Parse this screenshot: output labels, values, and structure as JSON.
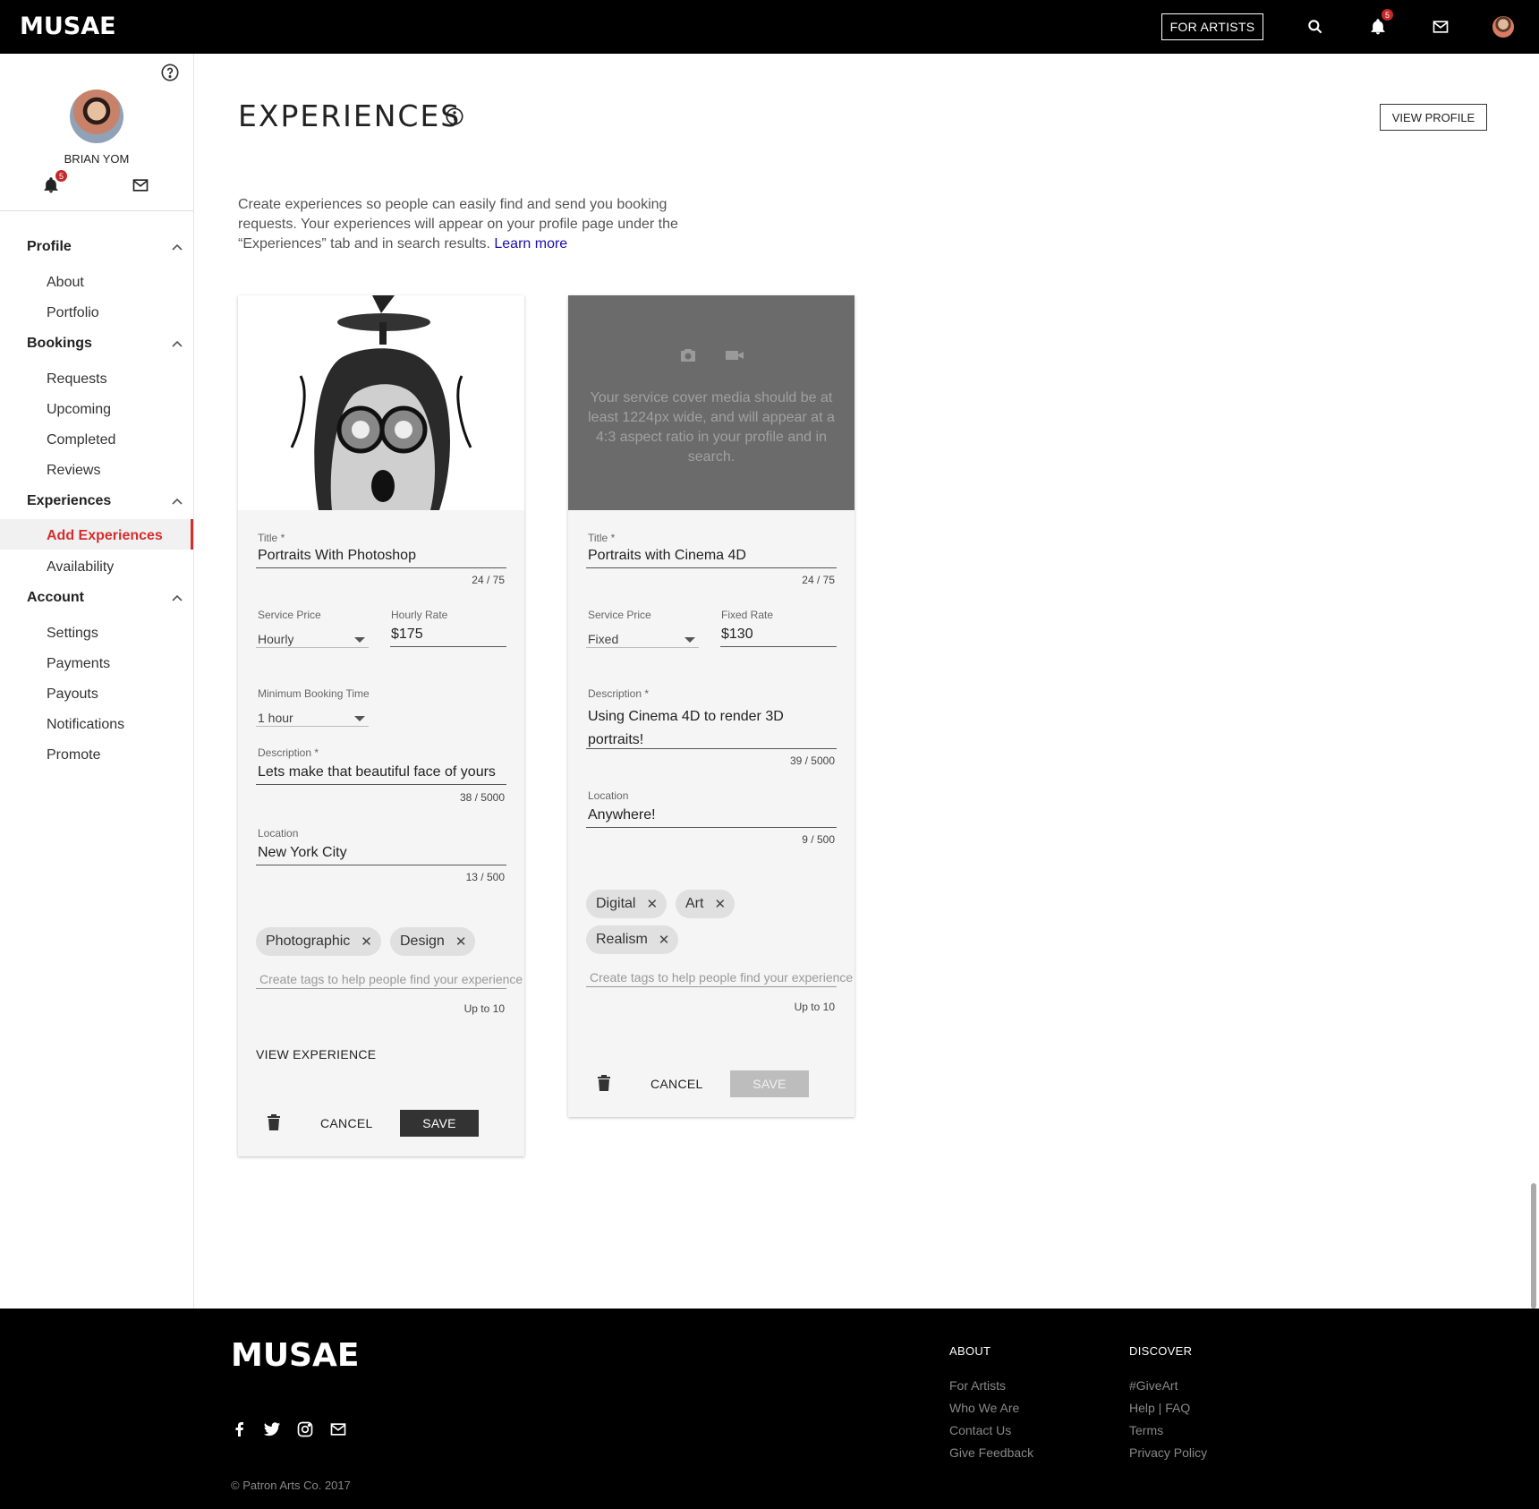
{
  "header": {
    "logo": "MUSAE",
    "for_artists_label": "FOR ARTISTS",
    "notification_count": "5"
  },
  "sidebar": {
    "user_name": "BRIAN YOM",
    "notification_count": "5",
    "sections": [
      {
        "label": "Profile",
        "items": [
          "About",
          "Portfolio"
        ]
      },
      {
        "label": "Bookings",
        "items": [
          "Requests",
          "Upcoming",
          "Completed",
          "Reviews"
        ]
      },
      {
        "label": "Experiences",
        "items": [
          "Add Experiences",
          "Availability"
        ]
      },
      {
        "label": "Account",
        "items": [
          "Settings",
          "Payments",
          "Payouts",
          "Notifications",
          "Promote"
        ]
      }
    ],
    "active_item": "Add Experiences"
  },
  "main": {
    "title": "EXPERIENCES",
    "view_profile_label": "VIEW PROFILE",
    "intro_text": "Create experiences so people can easily find and send you booking requests. Your experiences will appear on your profile page under the “Experiences” tab and in search results.",
    "learn_more": "Learn more"
  },
  "cards": [
    {
      "title_label": "Title",
      "title_value": "Portraits With Photoshop",
      "title_counter": "24 / 75",
      "price_label": "Service Price",
      "price_value": "Hourly",
      "rate_label": "Hourly Rate",
      "rate_value": "$175",
      "min_booking_label": "Minimum Booking Time",
      "min_booking_value": "1 hour",
      "description_label": "Description",
      "description_value": "Lets make that beautiful face of yours",
      "description_counter": "38 / 5000",
      "location_label": "Location",
      "location_value": "New York City",
      "location_counter": "13 / 500",
      "tags": [
        "Photographic",
        "Design"
      ],
      "tag_placeholder": "Create tags to help people find your experience",
      "tag_limit": "Up to 10",
      "view_experience_label": "VIEW EXPERIENCE",
      "cancel_label": "CANCEL",
      "save_label": "SAVE"
    },
    {
      "media_hint": "Your service cover media should be at least 1224px wide, and will appear at a 4:3 aspect ratio in your profile and in search.",
      "title_label": "Title",
      "title_value": "Portraits with Cinema 4D",
      "title_counter": "24 / 75",
      "price_label": "Service Price",
      "price_value": "Fixed",
      "rate_label": "Fixed Rate",
      "rate_value": "$130",
      "description_label": "Description",
      "description_value": "Using Cinema 4D to render 3D portraits!",
      "description_counter": "39 / 5000",
      "location_label": "Location",
      "location_value": "Anywhere!",
      "location_counter": "9 / 500",
      "tags": [
        "Digital",
        "Art",
        "Realism"
      ],
      "tag_placeholder": "Create tags to help people find your experience",
      "tag_limit": "Up to 10",
      "cancel_label": "CANCEL",
      "save_label": "SAVE"
    }
  ],
  "footer": {
    "logo": "MUSAE",
    "about_heading": "ABOUT",
    "about_links": [
      "For Artists",
      "Who We Are",
      "Contact Us",
      "Give Feedback"
    ],
    "discover_heading": "DISCOVER",
    "discover_links": [
      "#GiveArt",
      "Help | FAQ",
      "Terms",
      "Privacy Policy"
    ],
    "copyright": "© Patron Arts Co. 2017"
  }
}
